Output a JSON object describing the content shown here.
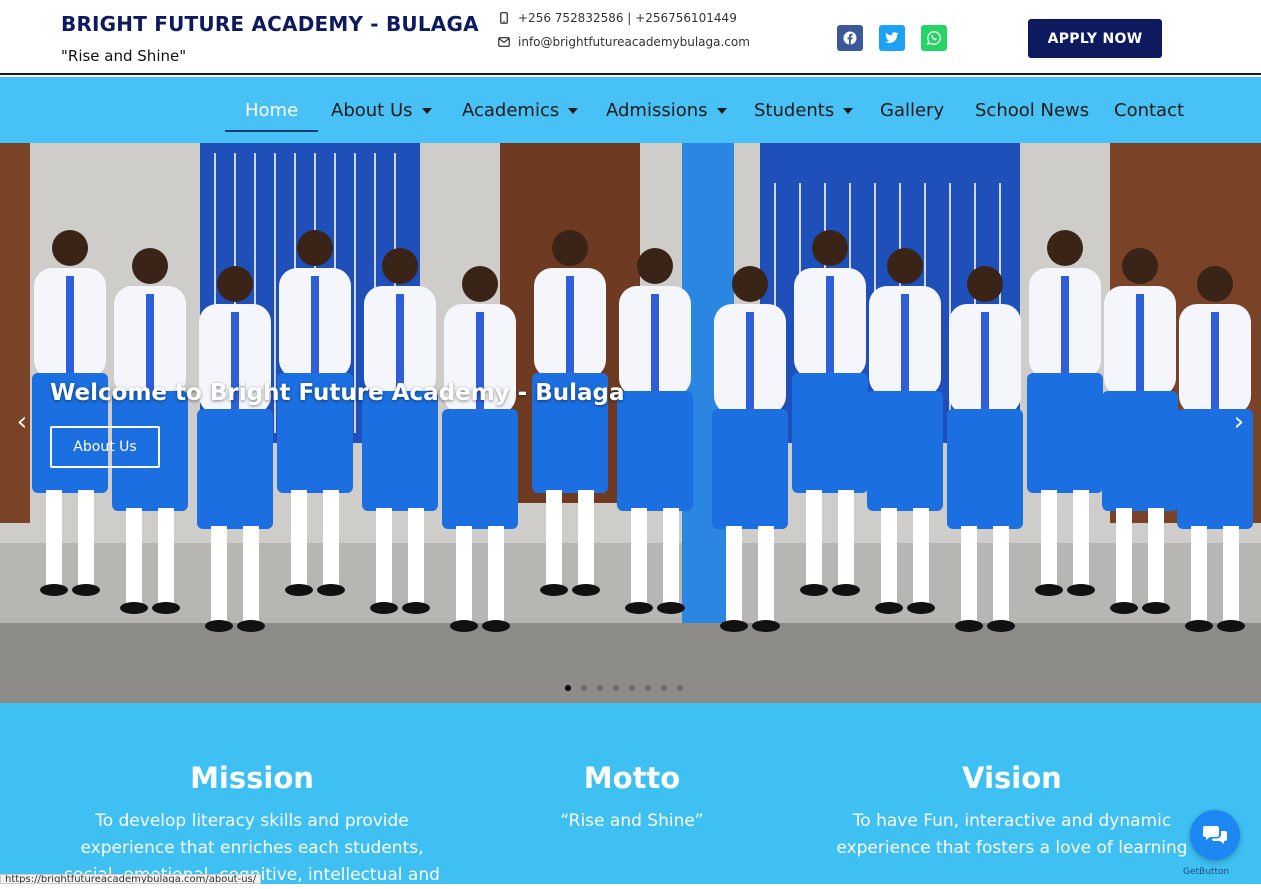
{
  "header": {
    "title": "BRIGHT FUTURE ACADEMY - BULAGA",
    "tagline": "\"Rise and Shine\"",
    "phone": "+256 752832586 | +256756101449",
    "email": "info@brightfutureacademybulaga.com",
    "apply_label": "APPLY NOW",
    "social": [
      {
        "name": "facebook-icon",
        "color": "#3b5998"
      },
      {
        "name": "twitter-icon",
        "color": "#1da1f2"
      },
      {
        "name": "whatsapp-icon",
        "color": "#25d366"
      }
    ]
  },
  "nav": {
    "items": [
      {
        "label": "Home",
        "active": true,
        "dropdown": false
      },
      {
        "label": "About Us",
        "active": false,
        "dropdown": true
      },
      {
        "label": "Academics",
        "active": false,
        "dropdown": true
      },
      {
        "label": "Admissions",
        "active": false,
        "dropdown": true
      },
      {
        "label": "Students",
        "active": false,
        "dropdown": true
      },
      {
        "label": "Gallery",
        "active": false,
        "dropdown": false
      },
      {
        "label": "School News",
        "active": false,
        "dropdown": false
      },
      {
        "label": "Contact",
        "active": false,
        "dropdown": false
      }
    ]
  },
  "hero": {
    "title": "Welcome to Bright Future Academy - Bulaga",
    "button_label": "About Us",
    "slide_count": 8,
    "active_slide": 1
  },
  "info": {
    "mission": {
      "heading": "Mission",
      "text": "To develop literacy skills and provide experience that enriches each students, social, emotional, cognitive, intellectual and"
    },
    "motto": {
      "heading": "Motto",
      "text": "“Rise and Shine”"
    },
    "vision": {
      "heading": "Vision",
      "text": "To have   Fun, interactive and dynamic experience that fosters a love of learning"
    }
  },
  "status_url": "https://brightfutureacademybulaga.com/about-us/",
  "getbutton_label": "GetButton",
  "colors": {
    "brand_dark": "#0d1b5e",
    "nav_blue": "#47c1f6",
    "info_blue": "#3ec0f2"
  }
}
